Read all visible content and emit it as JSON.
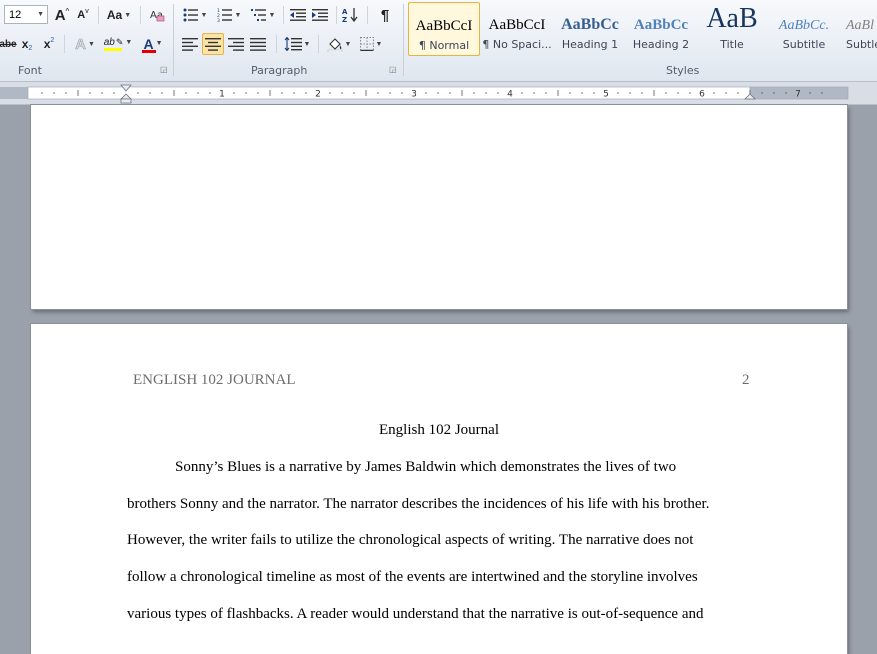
{
  "ribbon": {
    "font_size_value": "12",
    "groups": {
      "font": "Font",
      "paragraph": "Paragraph",
      "styles": "Styles"
    },
    "font": {
      "grow": "A",
      "shrink": "A",
      "change_case": "Aa",
      "strikethrough": "abe",
      "subscript": "x",
      "superscript": "x",
      "text_effects": "A",
      "highlight": "ab",
      "font_color": "A",
      "highlight_color": "#ffff00",
      "font_color_value": "#e00000"
    },
    "paragraph": {
      "pilcrow": "¶",
      "sort": "A↓Z"
    },
    "styles": [
      {
        "preview": "AaBbCcI",
        "name": "¶ Normal",
        "selected": true
      },
      {
        "preview": "AaBbCcI",
        "name": "¶ No Spaci..."
      },
      {
        "preview": "AaBbCc",
        "name": "Heading 1"
      },
      {
        "preview": "AaBbCc",
        "name": "Heading 2"
      },
      {
        "preview": "AaB",
        "name": "Title"
      },
      {
        "preview": "AaBbCc.",
        "name": "Subtitle"
      },
      {
        "preview": "AaBl",
        "name": "Subtle"
      }
    ]
  },
  "ruler": {
    "numbers": [
      "1",
      "2",
      "3",
      "4",
      "5",
      "6",
      "7"
    ]
  },
  "document": {
    "header_left": "ENGLISH 102 JOURNAL",
    "page_number": "2",
    "title": "English 102 Journal",
    "lines": [
      "Sonny’s Blues is a narrative by James Baldwin which demonstrates the lives of two",
      "brothers Sonny and the narrator. The narrator describes the incidences of his life with his brother.",
      "However, the writer fails to utilize the chronological aspects of writing. The narrative does not",
      "follow a chronological timeline as most of the events are intertwined and the storyline involves",
      "various types of flashbacks. A reader would understand that the narrative is out-of-sequence and"
    ]
  },
  "colors": {
    "workspace": "#9aa1ab",
    "selected_style_border": "#e3b643",
    "heading_blue": "#365f91",
    "title_navy": "#17365d"
  }
}
